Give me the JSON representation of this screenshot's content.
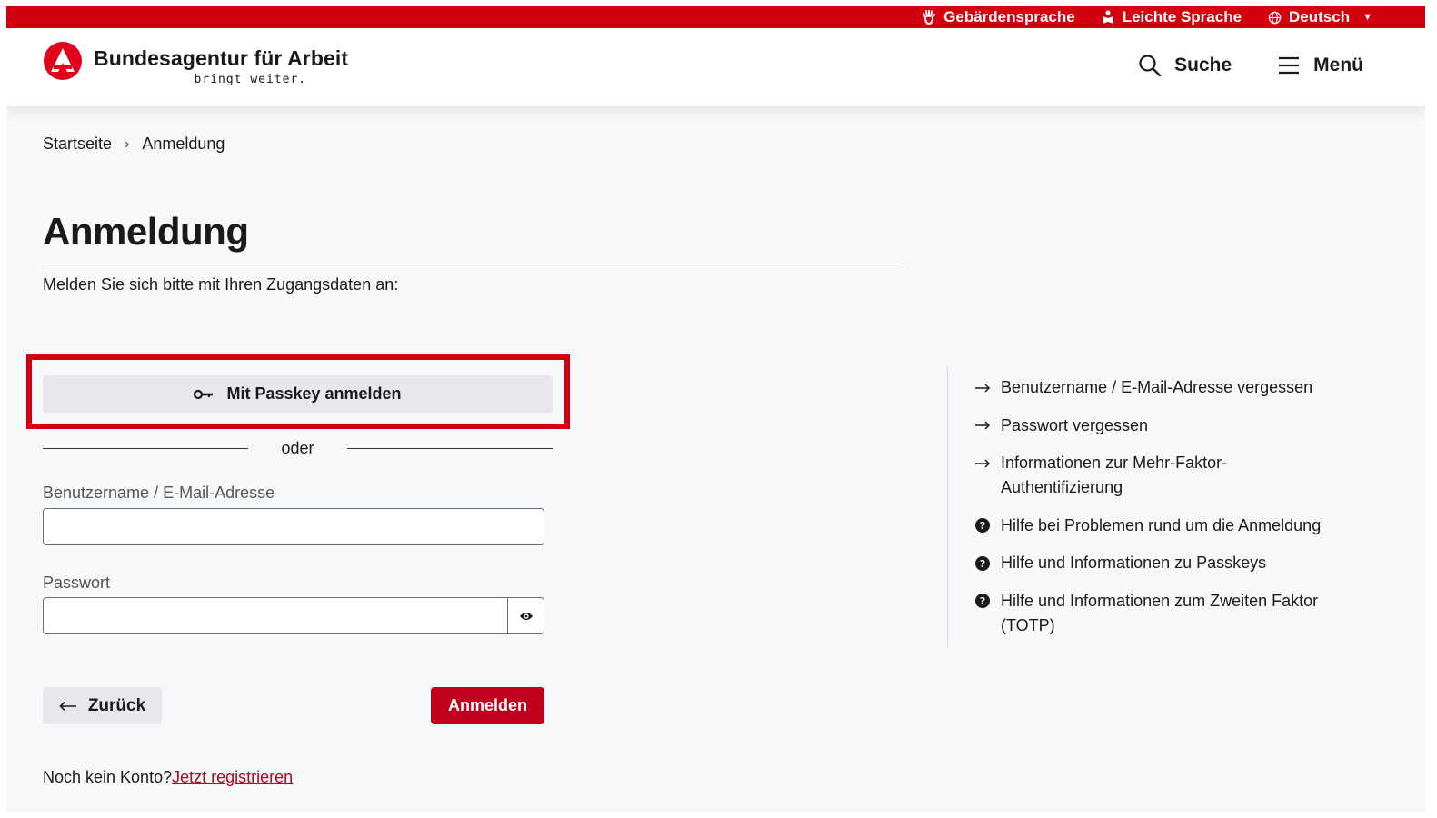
{
  "topbar": {
    "sign_language": "Gebärdensprache",
    "easy_language": "Leichte Sprache",
    "language": "Deutsch"
  },
  "header": {
    "logo_title": "Bundesagentur für Arbeit",
    "logo_subtitle": "bringt weiter.",
    "search_label": "Suche",
    "menu_label": "Menü"
  },
  "breadcrumb": {
    "home": "Startseite",
    "current": "Anmeldung"
  },
  "main": {
    "title": "Anmeldung",
    "intro": "Melden Sie sich bitte mit Ihren Zugangsdaten an:",
    "passkey_button": "Mit Passkey anmelden",
    "separator": "oder",
    "username_label": "Benutzername / E-Mail-Adresse",
    "username_value": "",
    "password_label": "Passwort",
    "password_value": "",
    "back_button": "Zurück",
    "login_button": "Anmelden",
    "no_account": "Noch kein Konto?",
    "register_link": "Jetzt registrieren"
  },
  "help": {
    "items": [
      {
        "icon": "arrow-right-icon",
        "label": "Benutzername / E-Mail-Adresse vergessen"
      },
      {
        "icon": "arrow-right-icon",
        "label": "Passwort vergessen"
      },
      {
        "icon": "arrow-right-icon",
        "label": "Informationen zur Mehr-Faktor-Authentifizierung"
      },
      {
        "icon": "question-circle-icon",
        "label": "Hilfe bei Problemen rund um die Anmeldung"
      },
      {
        "icon": "question-circle-icon",
        "label": "Hilfe und Informationen zu Passkeys"
      },
      {
        "icon": "question-circle-icon",
        "label": "Hilfe und Informationen zum Zweiten Faktor (TOTP)"
      }
    ]
  },
  "colors": {
    "brand_red": "#d4000f",
    "button_red": "#c0001d",
    "secondary_button": "#e6e8eb"
  }
}
